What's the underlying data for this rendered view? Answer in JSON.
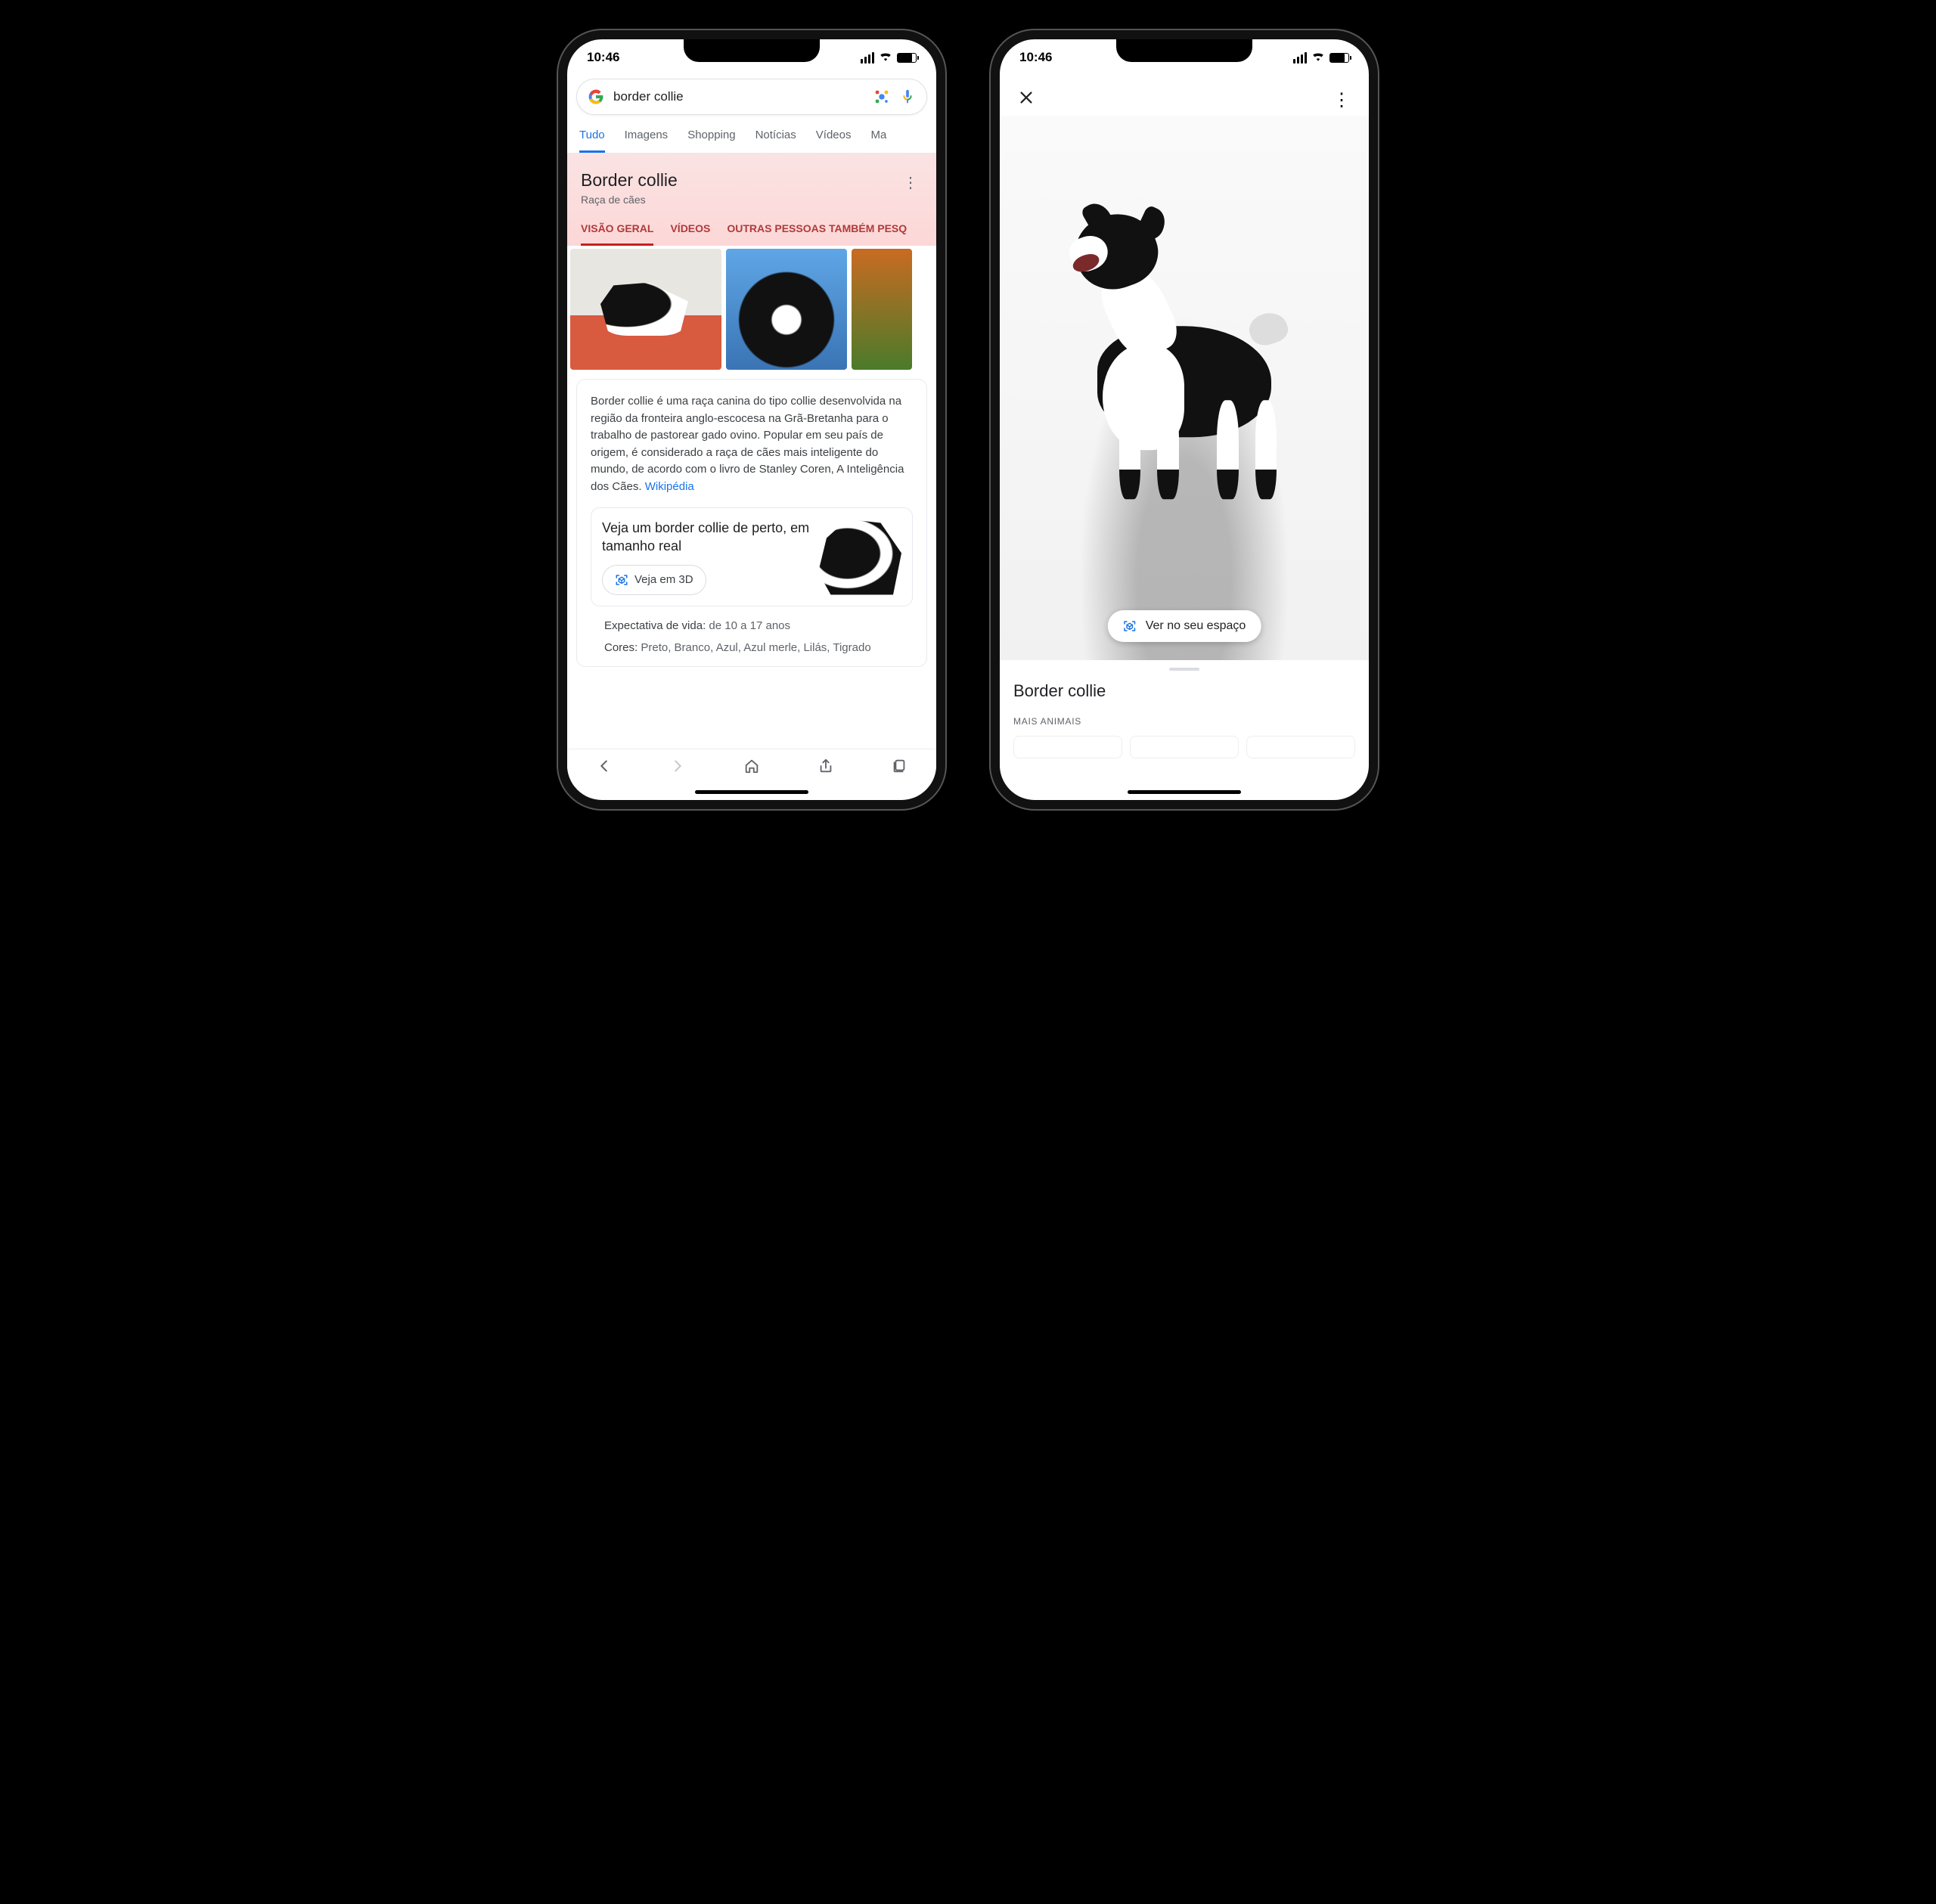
{
  "status": {
    "time": "10:46"
  },
  "phone1": {
    "search": {
      "query": "border collie"
    },
    "tabs": [
      "Tudo",
      "Imagens",
      "Shopping",
      "Notícias",
      "Vídeos",
      "Ma"
    ],
    "kp": {
      "title": "Border collie",
      "subtitle": "Raça de cães",
      "tabs": [
        "VISÃO GERAL",
        "VÍDEOS",
        "OUTRAS PESSOAS TAMBÉM PESQ"
      ],
      "description": "Border collie é uma raça canina do tipo collie desenvolvida na região da fronteira anglo-escocesa na Grã-Bretanha para o trabalho de pastorear gado ovino. Popular em seu país de origem, é considerado a raça de cães mais inteligente do mundo, de acordo com o livro de Stanley Coren, A Inteligência dos Cães. ",
      "source_label": "Wikipédia",
      "ar_prompt": "Veja um border collie de perto, em tamanho real",
      "ar_button": "Veja em 3D",
      "life": {
        "label": "Expectativa de vida: ",
        "value": "de 10 a 17 anos"
      },
      "colors": {
        "label": "Cores: ",
        "value": "Preto, Branco, Azul, Azul merle, Lilás, Tigrado"
      }
    }
  },
  "phone2": {
    "viewer_button": "Ver no seu espaço",
    "sheet_title": "Border collie",
    "sheet_sub": "MAIS ANIMAIS"
  }
}
